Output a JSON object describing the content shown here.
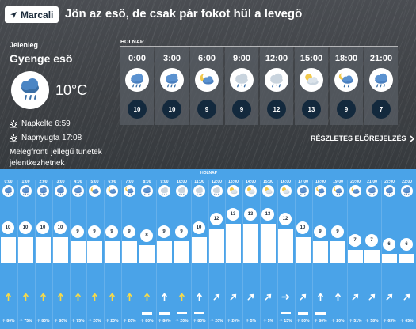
{
  "header": {
    "location_label": "Marcali",
    "headline": "Jön az eső, de csak pár fokot hűl a levegő"
  },
  "current": {
    "label": "Jelenleg",
    "condition": "Gyenge eső",
    "icon": "light-rain-icon",
    "temperature": "10°C",
    "sunrise": "Napkelte 6:59",
    "sunset": "Napnyugta 17:08",
    "warning": "Melegfronti jellegű tünetek jelentkezhetnek"
  },
  "top_forecast": {
    "day_label": "HOLNAP",
    "details_label": "RÉSZLETES ELŐREJELZÉS",
    "hours": [
      {
        "time": "0:00",
        "icon": "rain",
        "temp": "10"
      },
      {
        "time": "3:00",
        "icon": "rain",
        "temp": "10"
      },
      {
        "time": "6:00",
        "icon": "night-cloud",
        "temp": "9"
      },
      {
        "time": "9:00",
        "icon": "snow-rain",
        "temp": "9"
      },
      {
        "time": "12:00",
        "icon": "snow-rain",
        "temp": "12"
      },
      {
        "time": "15:00",
        "icon": "sun-cloud",
        "temp": "13"
      },
      {
        "time": "18:00",
        "icon": "night-rain",
        "temp": "9"
      },
      {
        "time": "21:00",
        "icon": "rain",
        "temp": "7"
      }
    ]
  },
  "hourly": {
    "day_label": "HOLNAP",
    "hours": [
      {
        "time": "0:00",
        "icon": "rain",
        "temp": 10,
        "wind_dir": "N",
        "wind_color": "#f5d94a",
        "precip_level": 0,
        "precip": "80%"
      },
      {
        "time": "1:00",
        "icon": "rain",
        "temp": 10,
        "wind_dir": "N",
        "wind_color": "#f5d94a",
        "precip_level": 0,
        "precip": "75%"
      },
      {
        "time": "2:00",
        "icon": "rain",
        "temp": 10,
        "wind_dir": "N",
        "wind_color": "#f5d94a",
        "precip_level": 0,
        "precip": "80%"
      },
      {
        "time": "3:00",
        "icon": "rain",
        "temp": 10,
        "wind_dir": "N",
        "wind_color": "#f5d94a",
        "precip_level": 0,
        "precip": "80%"
      },
      {
        "time": "4:00",
        "icon": "rain",
        "temp": 9,
        "wind_dir": "N",
        "wind_color": "#f5d94a",
        "precip_level": 0,
        "precip": "75%"
      },
      {
        "time": "5:00",
        "icon": "night-cloud",
        "temp": 9,
        "wind_dir": "N",
        "wind_color": "#f5d94a",
        "precip_level": 0,
        "precip": "20%"
      },
      {
        "time": "6:00",
        "icon": "night-cloud",
        "temp": 9,
        "wind_dir": "N",
        "wind_color": "#f5d94a",
        "precip_level": 0,
        "precip": "20%"
      },
      {
        "time": "7:00",
        "icon": "night-rain",
        "temp": 9,
        "wind_dir": "N",
        "wind_color": "#f5d94a",
        "precip_level": 0,
        "precip": "20%"
      },
      {
        "time": "8:00",
        "icon": "rain",
        "temp": 8,
        "wind_dir": "N",
        "wind_color": "#f5d94a",
        "precip_level": 0.6,
        "precip": "80%"
      },
      {
        "time": "9:00",
        "icon": "snow-rain",
        "temp": 9,
        "wind_dir": "N",
        "wind_color": "#ffffff",
        "precip_level": 0.6,
        "precip": "80%"
      },
      {
        "time": "10:00",
        "icon": "snow-rain",
        "temp": 9,
        "wind_dir": "N",
        "wind_color": "#f5d94a",
        "precip_level": 0.3,
        "precip": "20%"
      },
      {
        "time": "11:00",
        "icon": "snow-rain",
        "temp": 10,
        "wind_dir": "N",
        "wind_color": "#ffffff",
        "precip_level": 0.3,
        "precip": "80%"
      },
      {
        "time": "12:00",
        "icon": "snow-rain",
        "temp": 12,
        "wind_dir": "NE",
        "wind_color": "#ffffff",
        "precip_level": 0,
        "precip": "20%"
      },
      {
        "time": "13:00",
        "icon": "sun-cloud",
        "temp": 13,
        "wind_dir": "NE",
        "wind_color": "#ffffff",
        "precip_level": 0,
        "precip": "20%"
      },
      {
        "time": "14:00",
        "icon": "sun-cloud",
        "temp": 13,
        "wind_dir": "NE",
        "wind_color": "#ffffff",
        "precip_level": 0,
        "precip": "5%"
      },
      {
        "time": "15:00",
        "icon": "sun-cloud",
        "temp": 13,
        "wind_dir": "NE",
        "wind_color": "#ffffff",
        "precip_level": 0,
        "precip": "5%"
      },
      {
        "time": "16:00",
        "icon": "sun-cloud",
        "temp": 12,
        "wind_dir": "E",
        "wind_color": "#ffffff",
        "precip_level": 0.3,
        "precip": "13%"
      },
      {
        "time": "17:00",
        "icon": "rain",
        "temp": 10,
        "wind_dir": "NE",
        "wind_color": "#ffffff",
        "precip_level": 0.6,
        "precip": "80%"
      },
      {
        "time": "18:00",
        "icon": "night-rain",
        "temp": 9,
        "wind_dir": "N",
        "wind_color": "#ffffff",
        "precip_level": 0.6,
        "precip": "80%"
      },
      {
        "time": "19:00",
        "icon": "night-rain",
        "temp": 9,
        "wind_dir": "N",
        "wind_color": "#ffffff",
        "precip_level": 0,
        "precip": "20%"
      },
      {
        "time": "20:00",
        "icon": "night-cloud",
        "temp": 7,
        "wind_dir": "NE",
        "wind_color": "#ffffff",
        "precip_level": 0,
        "precip": "51%"
      },
      {
        "time": "21:00",
        "icon": "rain",
        "temp": 7,
        "wind_dir": "NE",
        "wind_color": "#ffffff",
        "precip_level": 0,
        "precip": "58%"
      },
      {
        "time": "22:00",
        "icon": "rain",
        "temp": 6,
        "wind_dir": "NE",
        "wind_color": "#ffffff",
        "precip_level": 0,
        "precip": "63%"
      },
      {
        "time": "23:00",
        "icon": "rain",
        "temp": 6,
        "wind_dir": "NE",
        "wind_color": "#ffffff",
        "precip_level": 0,
        "precip": "65%"
      }
    ]
  }
}
